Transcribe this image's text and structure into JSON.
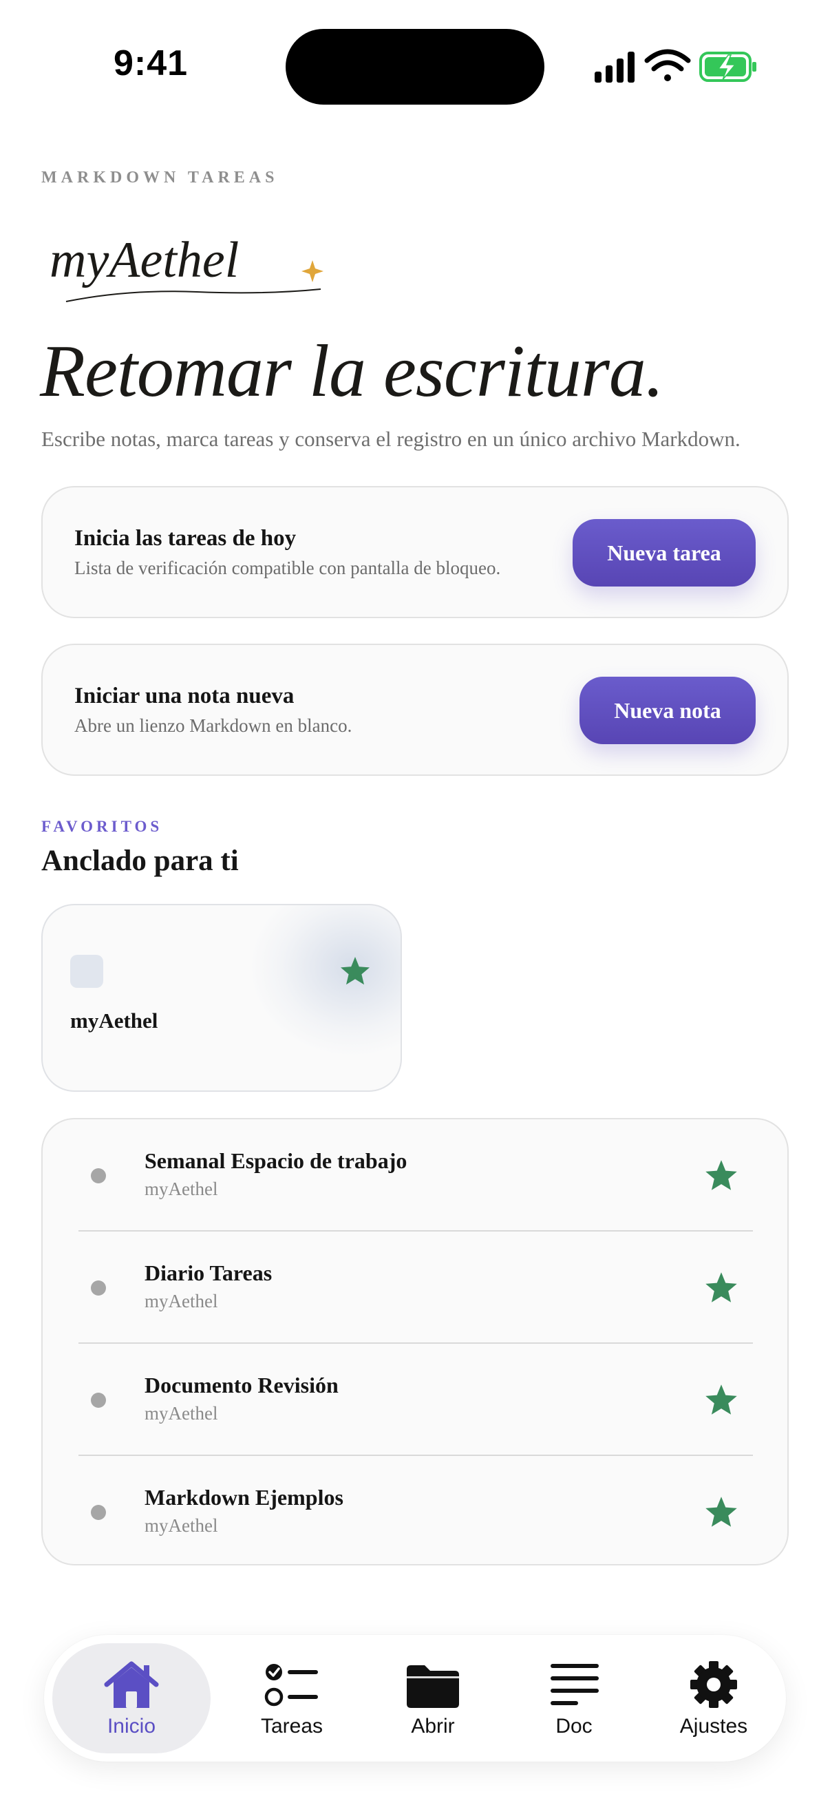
{
  "status_bar": {
    "time": "9:41",
    "icons": [
      "cellular-signal-icon",
      "wifi-icon",
      "battery-charging-icon"
    ]
  },
  "header": {
    "eyebrow": "MARKDOWN TAREAS",
    "logo_text": "myAethel",
    "title": "Retomar la escritura.",
    "subtitle": "Escribe notas, marca tareas y conserva el registro en un único archivo Markdown."
  },
  "actions": [
    {
      "title": "Inicia las tareas de hoy",
      "description": "Lista de verificación compatible con pantalla de bloqueo.",
      "button": "Nueva tarea"
    },
    {
      "title": "Iniciar una nota nueva",
      "description": "Abre un lienzo Markdown en blanco.",
      "button": "Nueva nota"
    }
  ],
  "favorites": {
    "eyebrow": "FAVORITOS",
    "title": "Anclado para ti",
    "pinned": {
      "title": "myAethel",
      "icon": "star-icon"
    },
    "items": [
      {
        "title": "Semanal Espacio de trabajo",
        "subtitle": "myAethel"
      },
      {
        "title": "Diario Tareas",
        "subtitle": "myAethel"
      },
      {
        "title": "Documento Revisión",
        "subtitle": "myAethel"
      },
      {
        "title": "Markdown Ejemplos",
        "subtitle": "myAethel"
      }
    ]
  },
  "tab_bar": {
    "tabs": [
      {
        "label": "Inicio",
        "icon": "house-icon",
        "active": true
      },
      {
        "label": "Tareas",
        "icon": "checklist-icon",
        "active": false
      },
      {
        "label": "Abrir",
        "icon": "folder-icon",
        "active": false
      },
      {
        "label": "Doc",
        "icon": "text-lines-icon",
        "active": false
      },
      {
        "label": "Ajustes",
        "icon": "gear-icon",
        "active": false
      }
    ]
  },
  "colors": {
    "accent": "#5b4fc4",
    "star": "#3a8b5c",
    "logo_sparkle": "#e0a63a",
    "battery": "#34c759"
  }
}
